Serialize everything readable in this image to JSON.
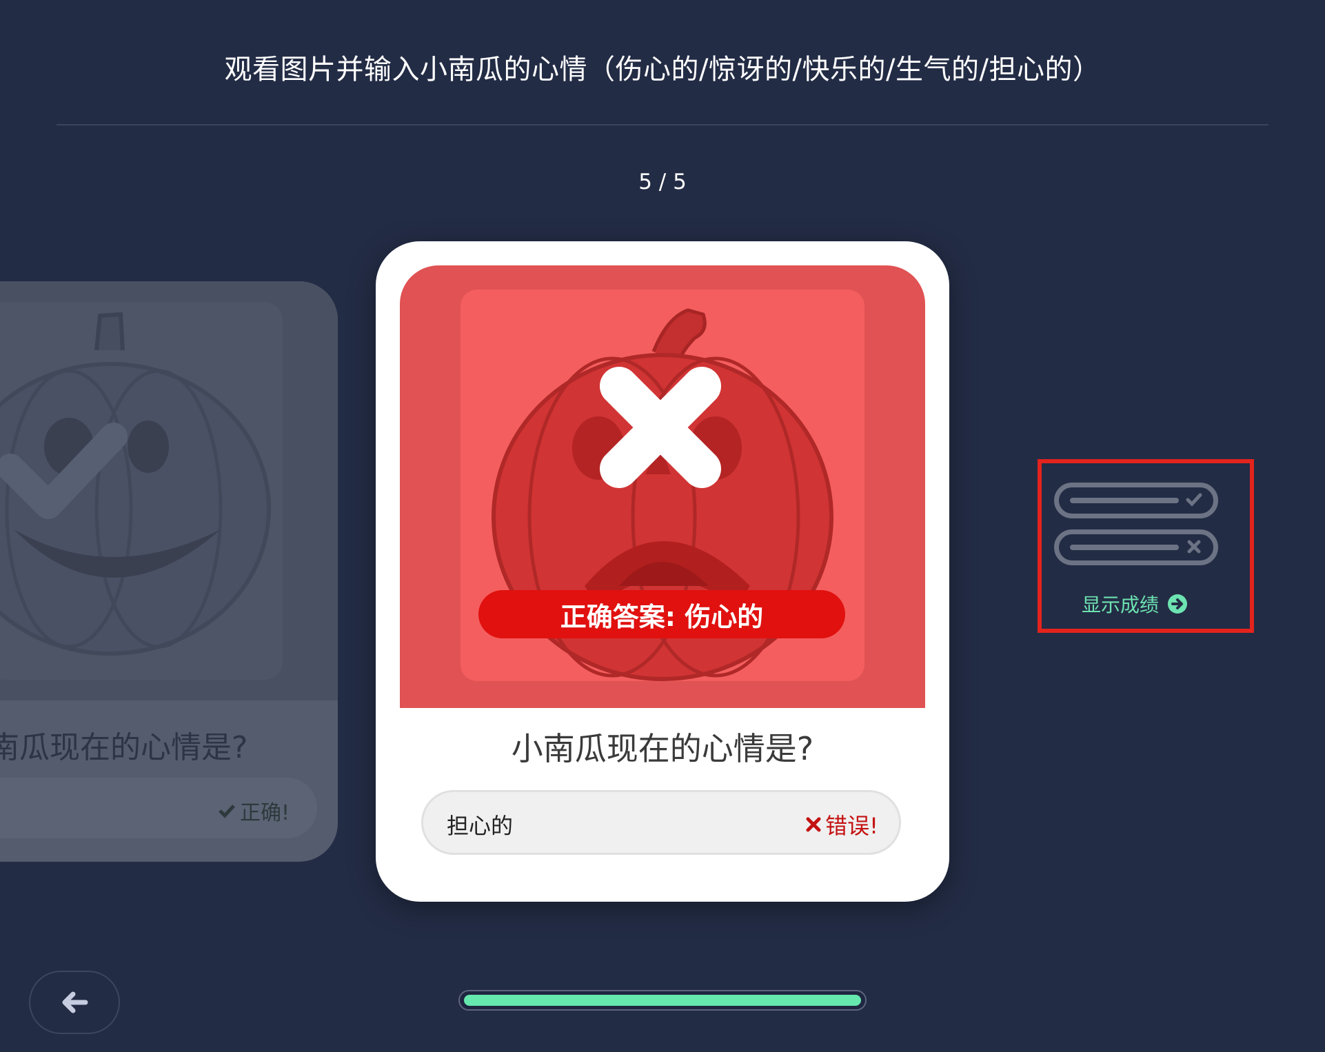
{
  "instruction": "观看图片并输入小南瓜的心情（伤心的/惊讶的/快乐的/生气的/担心的）",
  "progress": {
    "label": "5 / 5",
    "fraction": 1.0
  },
  "previous_card": {
    "question": "小南瓜现在的心情是?",
    "feedback": "正确!",
    "result_icon": "check-icon"
  },
  "current_card": {
    "correct_answer_banner": "正确答案: 伤心的",
    "question": "小南瓜现在的心情是?",
    "answer": "担心的",
    "feedback": "错误!",
    "result_icon": "cross-icon",
    "colors": {
      "image_bg": "#e05253",
      "feedback_wrong": "#c41212"
    }
  },
  "results_button": {
    "label": "显示成绩",
    "icon": "arrow-right-circle-icon"
  },
  "back_button": {
    "icon": "arrow-left-icon"
  },
  "colors": {
    "background": "#232c45",
    "accent": "#66e7ae"
  }
}
